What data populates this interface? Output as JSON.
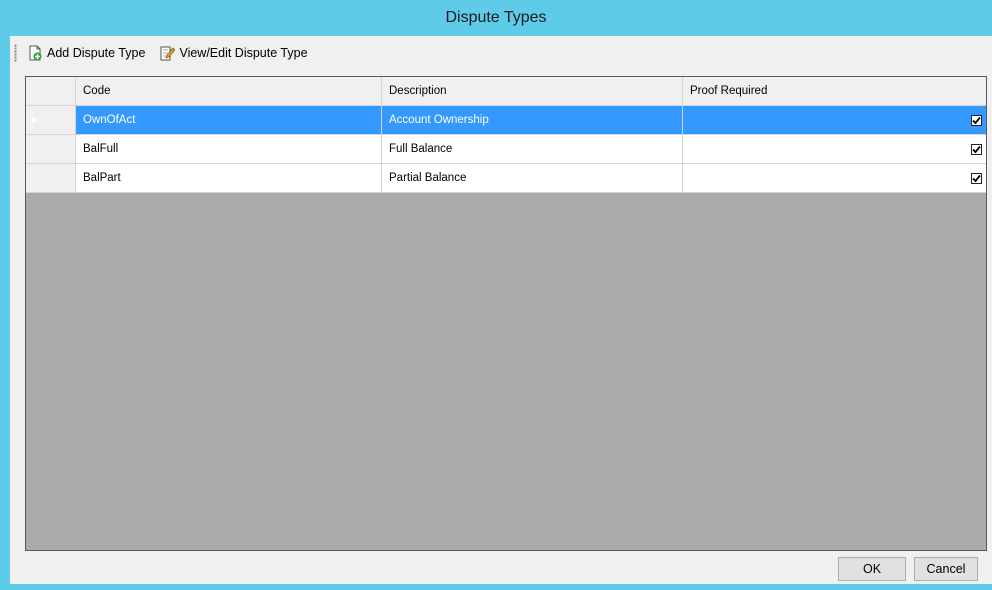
{
  "window": {
    "title": "Dispute Types"
  },
  "toolbar": {
    "add_label": "Add Dispute Type",
    "edit_label": "View/Edit Dispute Type"
  },
  "grid": {
    "columns": [
      "Code",
      "Description",
      "Proof Required"
    ],
    "rows": [
      {
        "code": "OwnOfAct",
        "description": "Account Ownership",
        "proof_required": true,
        "selected": true
      },
      {
        "code": "BalFull",
        "description": "Full Balance",
        "proof_required": true,
        "selected": false
      },
      {
        "code": "BalPart",
        "description": "Partial Balance",
        "proof_required": true,
        "selected": false
      }
    ]
  },
  "buttons": {
    "ok_label": "OK",
    "cancel_label": "Cancel"
  },
  "colors": {
    "title_bar": "#5ecbe8",
    "selection": "#3399ff",
    "grid_background": "#ababab"
  }
}
